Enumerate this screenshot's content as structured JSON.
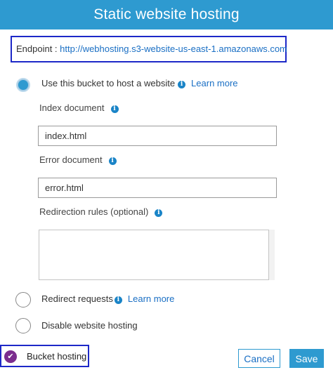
{
  "dialog": {
    "title": "Static website hosting"
  },
  "endpoint": {
    "label": "Endpoint :",
    "url": "http://webhosting.s3-website-us-east-1.amazonaws.com"
  },
  "options": {
    "host": {
      "label": "Use this bucket to host a website",
      "learn_more": "Learn more",
      "selected": true
    },
    "redirect": {
      "label": "Redirect requests",
      "learn_more": "Learn more",
      "selected": false
    },
    "disable": {
      "label": "Disable website hosting",
      "selected": false
    }
  },
  "fields": {
    "index_document": {
      "label": "Index document",
      "value": "index.html"
    },
    "error_document": {
      "label": "Error document",
      "value": "error.html"
    },
    "redirection_rules": {
      "label": "Redirection rules (optional)",
      "value": ""
    }
  },
  "footer": {
    "status_label": "Bucket hosting",
    "cancel_label": "Cancel",
    "save_label": "Save"
  },
  "colors": {
    "accent": "#2e9ad0",
    "link": "#1a6fc4",
    "highlight_border": "#1d28c8",
    "check": "#7b2d8e"
  },
  "icons": {
    "info": "info-icon",
    "check": "check-circle-icon"
  }
}
